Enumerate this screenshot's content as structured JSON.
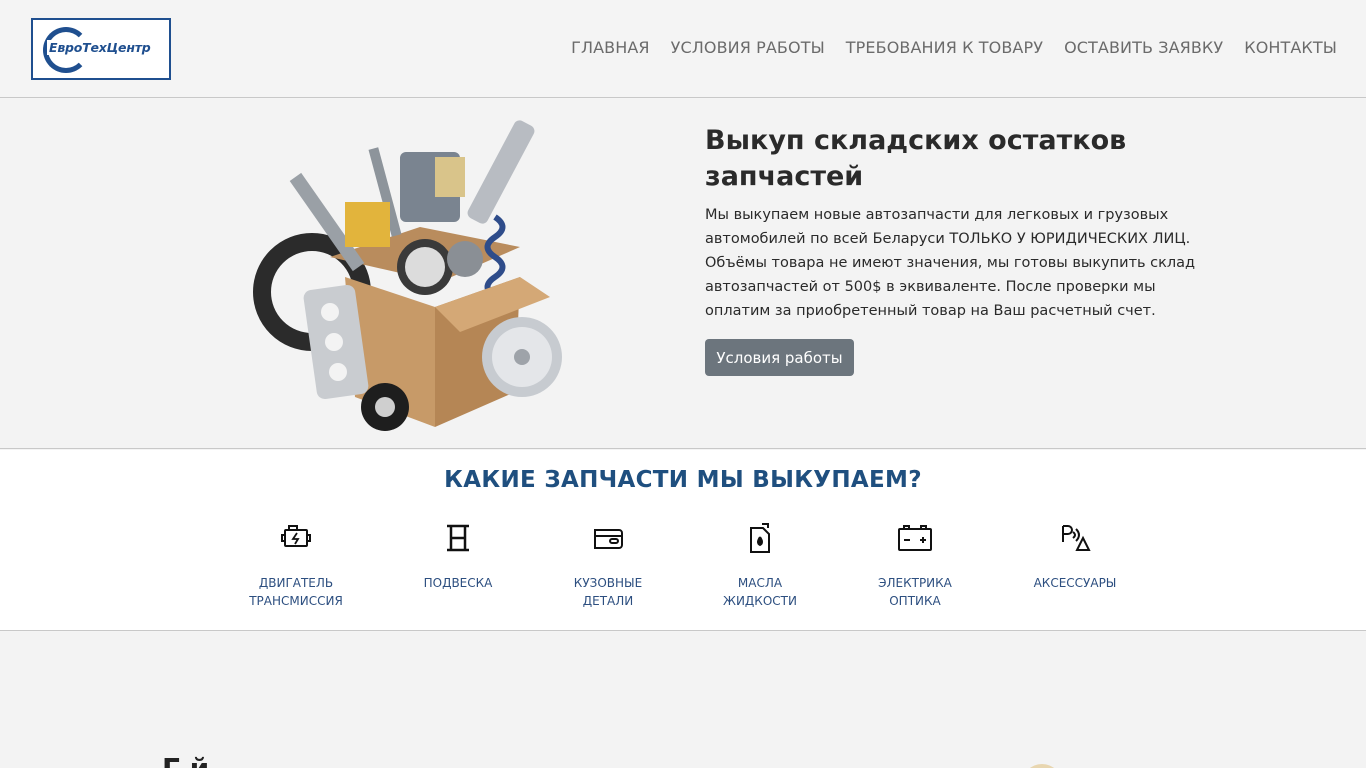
{
  "header": {
    "logo_text": "ЕвроТехЦентр",
    "nav": [
      "ГЛАВНАЯ",
      "УСЛОВИЯ РАБОТЫ",
      "ТРЕБОВАНИЯ К ТОВАРУ",
      "ОСТАВИТЬ ЗАЯВКУ",
      "КОНТАКТЫ"
    ]
  },
  "hero": {
    "title": "Выкуп складских остатков запчастей",
    "text": "Мы выкупаем новые автозапчасти для легковых и грузовых автомобилей по всей Беларуси ТОЛЬКО У ЮРИДИЧЕСКИХ ЛИЦ. Объёмы товара не имеют значения, мы готовы выкупить склад автозапчастей от 500$ в эквиваленте. После проверки мы оплатим за приобретенный товар на Ваш расчетный счет.",
    "button": "Условия работы",
    "image_icon": "auto-parts-box-image"
  },
  "parts": {
    "title": "КАКИЕ ЗАПЧАСТИ МЫ ВЫКУПАЕМ?",
    "items": [
      {
        "icon": "engine-icon",
        "line1": "ДВИГАТЕЛЬ",
        "line2": "ТРАНСМИССИЯ"
      },
      {
        "icon": "suspension-icon",
        "line1": "ПОДВЕСКА",
        "line2": ""
      },
      {
        "icon": "car-door-icon",
        "line1": "КУЗОВНЫЕ",
        "line2": "ДЕТАЛИ"
      },
      {
        "icon": "oil-canister-icon",
        "line1": "МАСЛА",
        "line2": "ЖИДКОСТИ"
      },
      {
        "icon": "battery-icon",
        "line1": "ЭЛЕКТРИКА",
        "line2": "ОПТИКА"
      },
      {
        "icon": "parking-sensor-icon",
        "line1": "АКСЕССУАРЫ",
        "line2": ""
      }
    ]
  },
  "bottom": {
    "title_partial": "Г                                                        й"
  },
  "colors": {
    "brand_blue": "#1f4f8f",
    "heading_blue": "#1f4f7f",
    "button_gray": "#6c757d"
  }
}
